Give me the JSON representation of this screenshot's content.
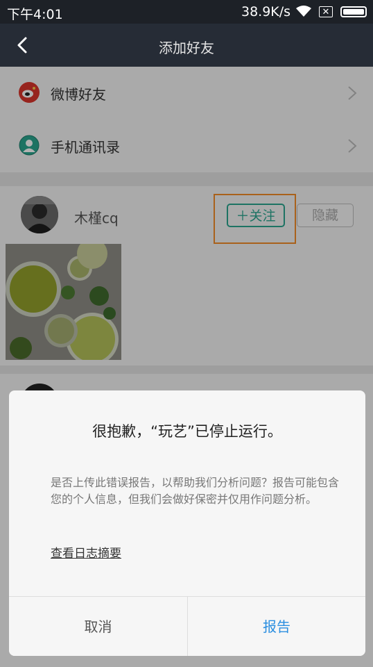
{
  "status_bar": {
    "time": "下午4:01",
    "speed": "38.9K/s",
    "sim_icon_glyph": "✕"
  },
  "navbar": {
    "title": "添加好友"
  },
  "menu": {
    "items": [
      {
        "label": "微博好友",
        "icon": "weibo-icon",
        "color": "#d9342b"
      },
      {
        "label": "手机通讯录",
        "icon": "contacts-icon",
        "color": "#2aa58f"
      }
    ]
  },
  "feed": {
    "user": {
      "name": "木槿cq",
      "follow_label": "＋关注",
      "hide_label": "隐藏"
    }
  },
  "dialog": {
    "title": "很抱歉，“玩艺”已停止运行。",
    "message": "是否上传此错误报告，以帮助我们分析问题？报告可能包含您的个人信息，但我们会做好保密并仅用作问题分析。",
    "link": "查看日志摘要",
    "cancel_label": "取消",
    "report_label": "报告"
  },
  "colors": {
    "accent_green": "#2aa58f",
    "highlight_orange": "#f28c28",
    "report_blue": "#2a8ee0",
    "navbar_bg": "#262c36"
  }
}
